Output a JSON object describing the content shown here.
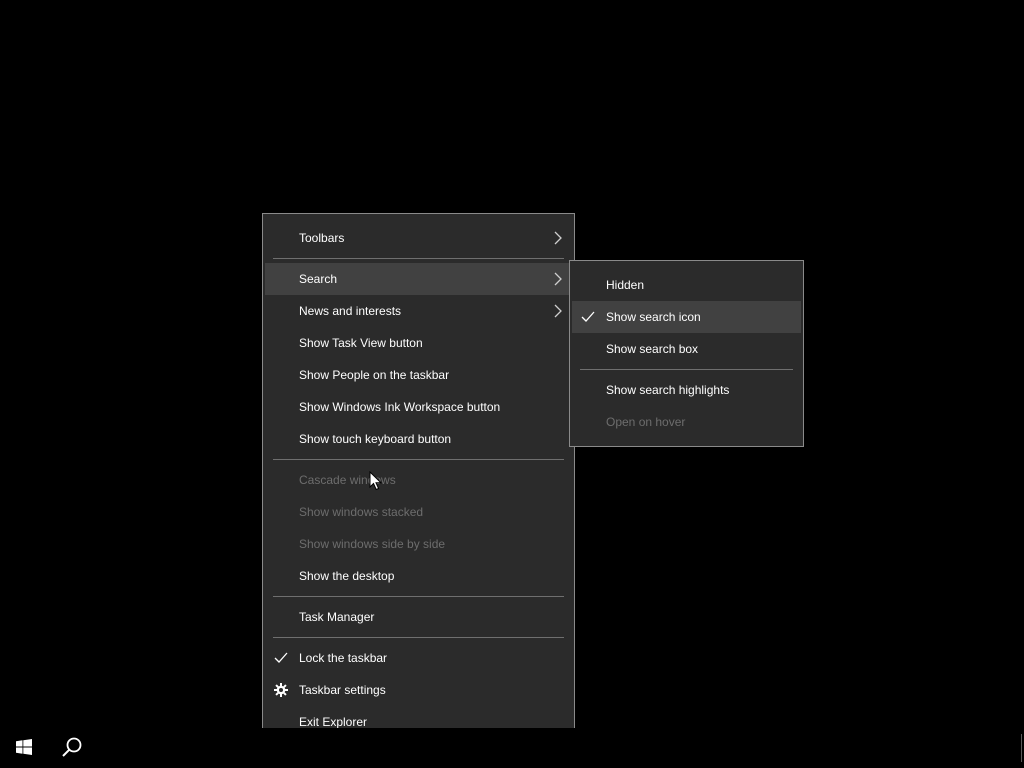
{
  "main_menu": {
    "items": [
      {
        "label": "Toolbars"
      },
      {
        "label": "Search"
      },
      {
        "label": "News and interests"
      },
      {
        "label": "Show Task View button"
      },
      {
        "label": "Show People on the taskbar"
      },
      {
        "label": "Show Windows Ink Workspace button"
      },
      {
        "label": "Show touch keyboard button"
      },
      {
        "label": "Cascade windows"
      },
      {
        "label": "Show windows stacked"
      },
      {
        "label": "Show windows side by side"
      },
      {
        "label": "Show the desktop"
      },
      {
        "label": "Task Manager"
      },
      {
        "label": "Lock the taskbar"
      },
      {
        "label": "Taskbar settings"
      },
      {
        "label": "Exit Explorer"
      }
    ]
  },
  "search_submenu": {
    "items": [
      {
        "label": "Hidden"
      },
      {
        "label": "Show search icon"
      },
      {
        "label": "Show search box"
      },
      {
        "label": "Show search highlights"
      },
      {
        "label": "Open on hover"
      }
    ]
  },
  "taskbar": {
    "start_icon": "windows-logo-icon",
    "search_icon": "search-icon"
  },
  "colors": {
    "menu_bg": "#2b2b2b",
    "menu_border": "#8a8a8a",
    "hover_bg": "#414141",
    "disabled_text": "#6d6d6d",
    "text": "#ffffff"
  }
}
